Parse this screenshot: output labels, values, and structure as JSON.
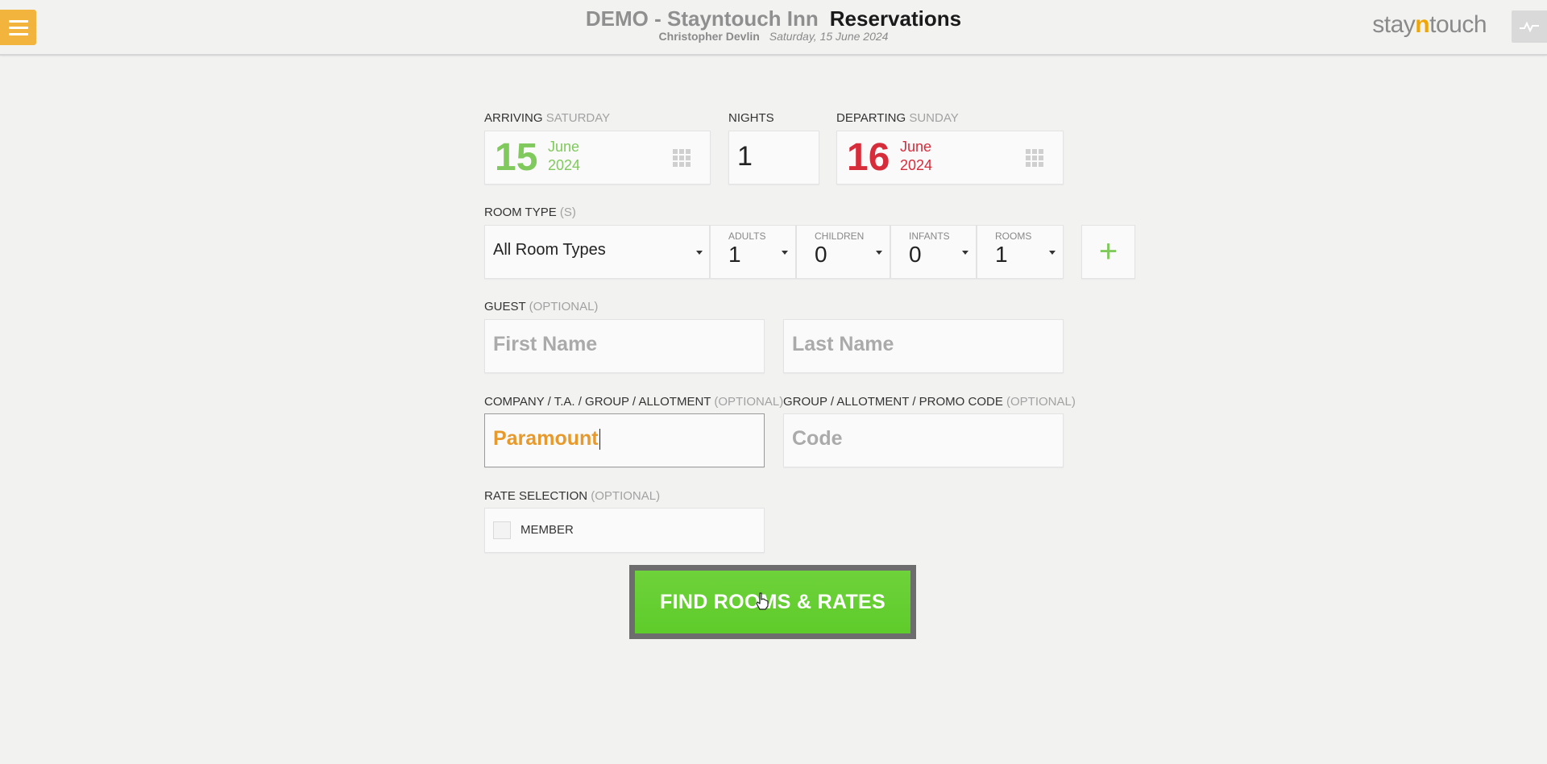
{
  "header": {
    "hotel_name": "DEMO - Stayntouch Inn",
    "page_title": "Reservations",
    "user_name": "Christopher Devlin",
    "date": "Saturday, 15 June 2024",
    "brand": {
      "pre": "stay",
      "mid": "n",
      "post": "touch"
    }
  },
  "arrival": {
    "label": "ARRIVING",
    "weekday": "SATURDAY",
    "day": "15",
    "month": "June",
    "year": "2024"
  },
  "nights": {
    "label": "NIGHTS",
    "value": "1"
  },
  "departure": {
    "label": "DEPARTING",
    "weekday": "SUNDAY",
    "day": "16",
    "month": "June",
    "year": "2024"
  },
  "room_type": {
    "label": "ROOM TYPE",
    "suffix": "(S)",
    "selected": "All Room Types"
  },
  "occupancy": {
    "adults": {
      "label": "ADULTS",
      "value": "1"
    },
    "children": {
      "label": "CHILDREN",
      "value": "0"
    },
    "infants": {
      "label": "INFANTS",
      "value": "0"
    },
    "rooms": {
      "label": "ROOMS",
      "value": "1"
    },
    "add_label": "+"
  },
  "guest": {
    "label": "GUEST",
    "optional": "(OPTIONAL)",
    "first_name_placeholder": "First Name",
    "last_name_placeholder": "Last Name"
  },
  "company": {
    "label": "COMPANY / T.A. / GROUP / ALLOTMENT",
    "optional": "(OPTIONAL)",
    "value": "Paramount"
  },
  "promo": {
    "label": "GROUP / ALLOTMENT / PROMO CODE",
    "optional": "(OPTIONAL)",
    "placeholder": "Code"
  },
  "rate_selection": {
    "label": "RATE SELECTION",
    "optional": "(OPTIONAL)",
    "member_label": "MEMBER",
    "member_checked": false
  },
  "find_button": {
    "label": "FIND ROOMS & RATES"
  },
  "colors": {
    "arrival": "#80c95c",
    "departure": "#d72d3b",
    "menu": "#f3b43d",
    "find_button": "#5ecc2b",
    "company_text": "#e79a2b"
  },
  "icons": [
    "menu-icon",
    "activity-icon",
    "calendar-icon",
    "plus-icon",
    "caret-down-icon",
    "mouse-pointer-icon"
  ]
}
